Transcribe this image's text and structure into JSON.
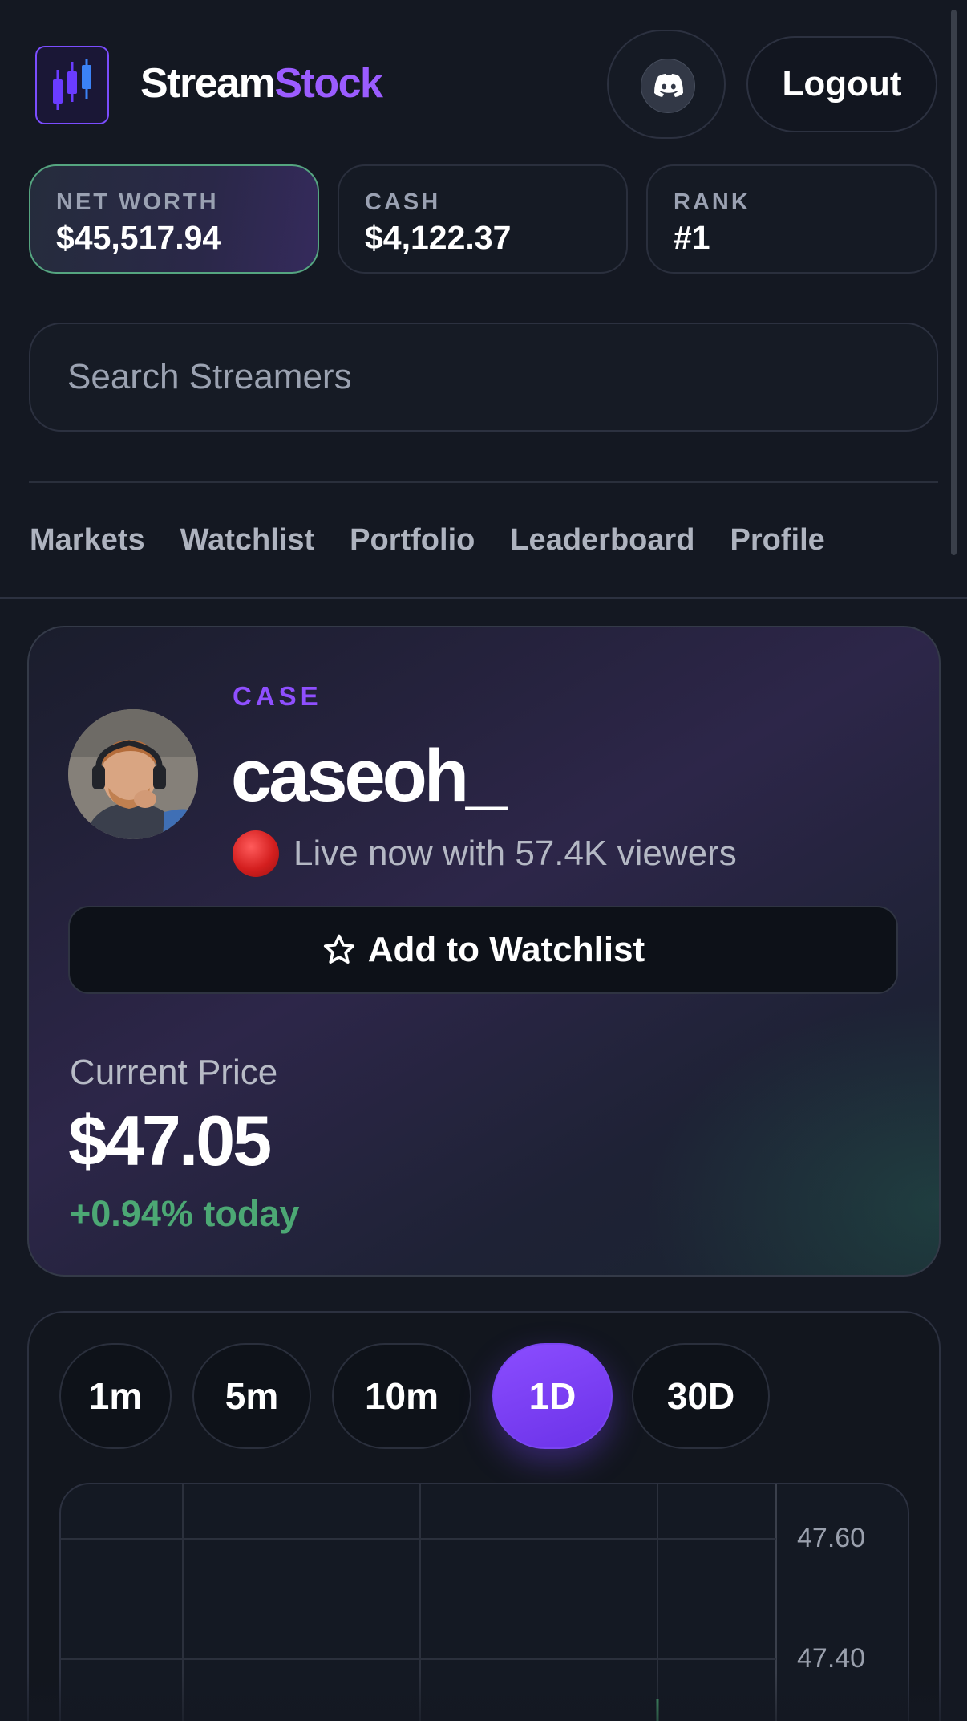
{
  "header": {
    "brand_part1": "Stream",
    "brand_part2": "Stock",
    "logout_label": "Logout",
    "logo_icon": "candlestick-chart-icon",
    "discord_icon": "discord-icon"
  },
  "stats": [
    {
      "label": "NET WORTH",
      "value": "$45,517.94"
    },
    {
      "label": "CASH",
      "value": "$4,122.37"
    },
    {
      "label": "RANK",
      "value": "#1"
    }
  ],
  "search": {
    "placeholder": "Search Streamers"
  },
  "nav": [
    "Markets",
    "Watchlist",
    "Portfolio",
    "Leaderboard",
    "Profile"
  ],
  "streamer": {
    "ticker": "CASE",
    "name": "caseoh_",
    "live_text": "Live now with 57.4K viewers",
    "watchlist_label": "Add to Watchlist",
    "price_label": "Current Price",
    "price": "$47.05",
    "change": "+0.94% today"
  },
  "chart": {
    "ranges": [
      "1m",
      "5m",
      "10m",
      "1D",
      "30D"
    ],
    "active_range": "1D",
    "y_ticks": [
      "47.60",
      "47.40"
    ]
  },
  "colors": {
    "accent": "#8b4dff",
    "positive": "#4ca874",
    "live": "#d41f1f",
    "background": "#141822"
  }
}
